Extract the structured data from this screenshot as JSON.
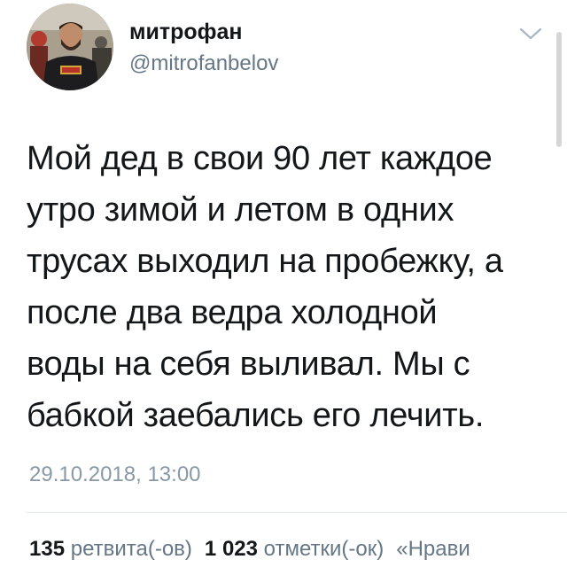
{
  "author": {
    "display_name": "митрофан",
    "username": "@mitrofanbelov",
    "avatar_icon": "user-avatar-photo"
  },
  "menu": {
    "icon": "chevron-down-icon"
  },
  "tweet": {
    "lines": [
      "Мой дед в свои 90 лет каждое",
      "утро зимой и летом в одних",
      "трусах выходил на пробежку, а",
      "после два ведра холодной",
      "воды на себя выливал. Мы с",
      "бабкой заебались его лечить."
    ],
    "timestamp": "29.10.2018, 13:00"
  },
  "stats": {
    "retweets_count": "135",
    "retweets_label": "ретвита(-ов)",
    "likes_count": "1 023",
    "likes_label": "отметки(-ок)",
    "more_label": "«Нрави"
  },
  "colors": {
    "text": "#14171a",
    "secondary": "#657786",
    "muted": "#8899a6",
    "divider": "#e1e8ed"
  }
}
